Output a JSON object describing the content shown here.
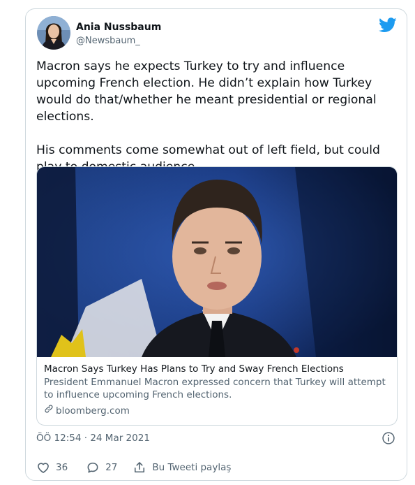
{
  "author": {
    "name": "Ania Nussbaum",
    "handle": "@Newsbaum_"
  },
  "tweet": {
    "paragraphs": [
      "Macron says he expects Turkey to try and influence upcoming French election. He didn’t explain how Turkey would do that/whether he meant presidential or regional elections.",
      "His comments come somewhat out of left field, but could play to domestic audience"
    ]
  },
  "link_card": {
    "title": "Macron Says Turkey Has Plans to Try and Sway French Elections",
    "description": "President Emmanuel Macron expressed concern that Turkey will attempt to influence upcoming French elections.",
    "domain": "bloomberg.com"
  },
  "timestamp": "ÖÖ 12:54 · 24 Mar 2021",
  "actions": {
    "likes": "36",
    "replies": "27",
    "share_label": "Bu Tweeti paylaş"
  },
  "colors": {
    "twitter_blue": "#1d9bf0",
    "secondary_text": "#536471",
    "border": "#cfd9de"
  },
  "icons": [
    "twitter-bird-icon",
    "info-icon",
    "link-icon",
    "heart-icon",
    "reply-icon",
    "share-icon"
  ]
}
